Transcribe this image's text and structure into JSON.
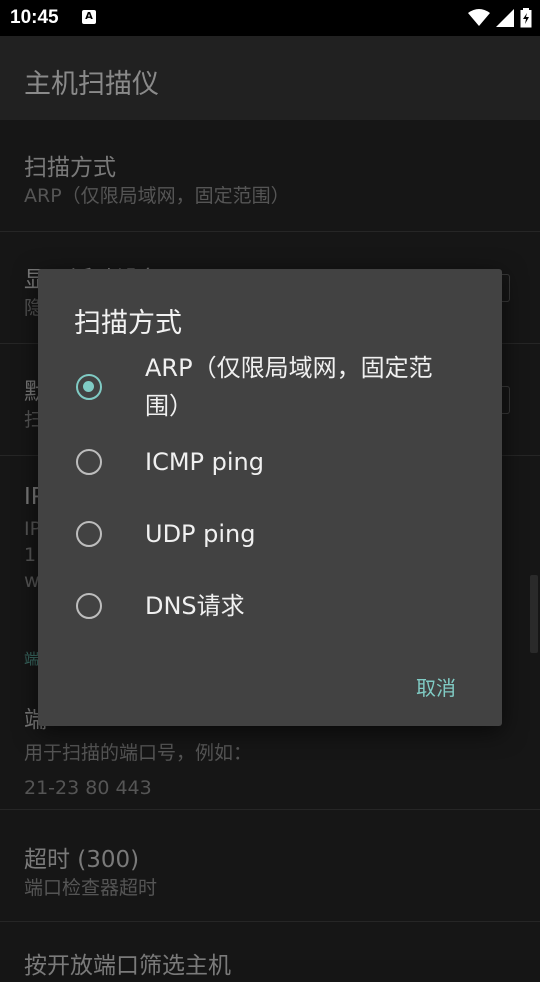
{
  "status_bar": {
    "time": "10:45",
    "notification_icon": "A"
  },
  "app_bar": {
    "title": "主机扫描仪"
  },
  "preferences": [
    {
      "title": "扫描方式",
      "summary": "ARP（仅限局域网，固定范围）"
    },
    {
      "title": "显示活动设备",
      "summary": "隐"
    },
    {
      "title": "默",
      "summary": "扫"
    },
    {
      "title": "IP",
      "summary": "IP\n1\nw"
    },
    {
      "section_header": "端"
    },
    {
      "title": "端",
      "summary": "用于扫描的端口号，例如：\n21-23 80 443"
    },
    {
      "title": "超时 (300)",
      "summary": "端口检查器超时"
    },
    {
      "title": "按开放端口筛选主机"
    }
  ],
  "dialog": {
    "title": "扫描方式",
    "options": [
      {
        "label": "ARP（仅限局域网，固定范围）",
        "checked": true
      },
      {
        "label": "ICMP ping",
        "checked": false
      },
      {
        "label": "UDP ping",
        "checked": false
      },
      {
        "label": "DNS请求",
        "checked": false
      }
    ],
    "cancel_label": "取消"
  },
  "colors": {
    "accent": "#80cbc4",
    "dialog_bg": "#424242",
    "app_bar_bg": "#212121"
  }
}
